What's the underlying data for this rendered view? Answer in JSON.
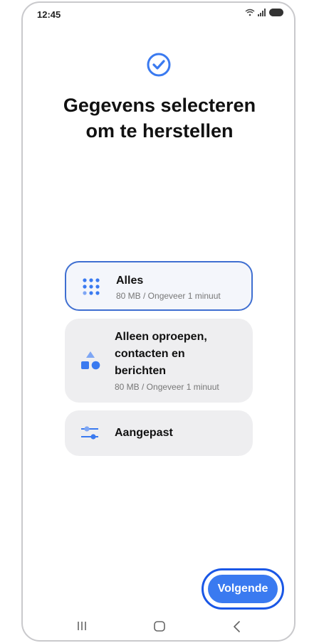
{
  "status_bar": {
    "time": "12:45"
  },
  "header": {
    "title_line1": "Gegevens selecteren",
    "title_line2": "om te herstellen"
  },
  "options": [
    {
      "title": "Alles",
      "subtitle": "80 MB / Ongeveer 1 minuut",
      "selected": true,
      "icon": "grid-dots-icon"
    },
    {
      "title_lines": [
        "Alleen oproepen,",
        "contacten en",
        "berichten"
      ],
      "subtitle": "80 MB / Ongeveer 1 minuut",
      "selected": false,
      "icon": "shapes-icon"
    },
    {
      "title": "Aangepast",
      "selected": false,
      "icon": "sliders-icon"
    }
  ],
  "next_button": {
    "label": "Volgende"
  },
  "colors": {
    "accent": "#3a7af0",
    "selected_border": "#3f6fd1",
    "card_bg": "#eeeef0"
  },
  "nav_bar": {
    "icons": [
      "recents-icon",
      "home-icon",
      "back-icon"
    ]
  }
}
